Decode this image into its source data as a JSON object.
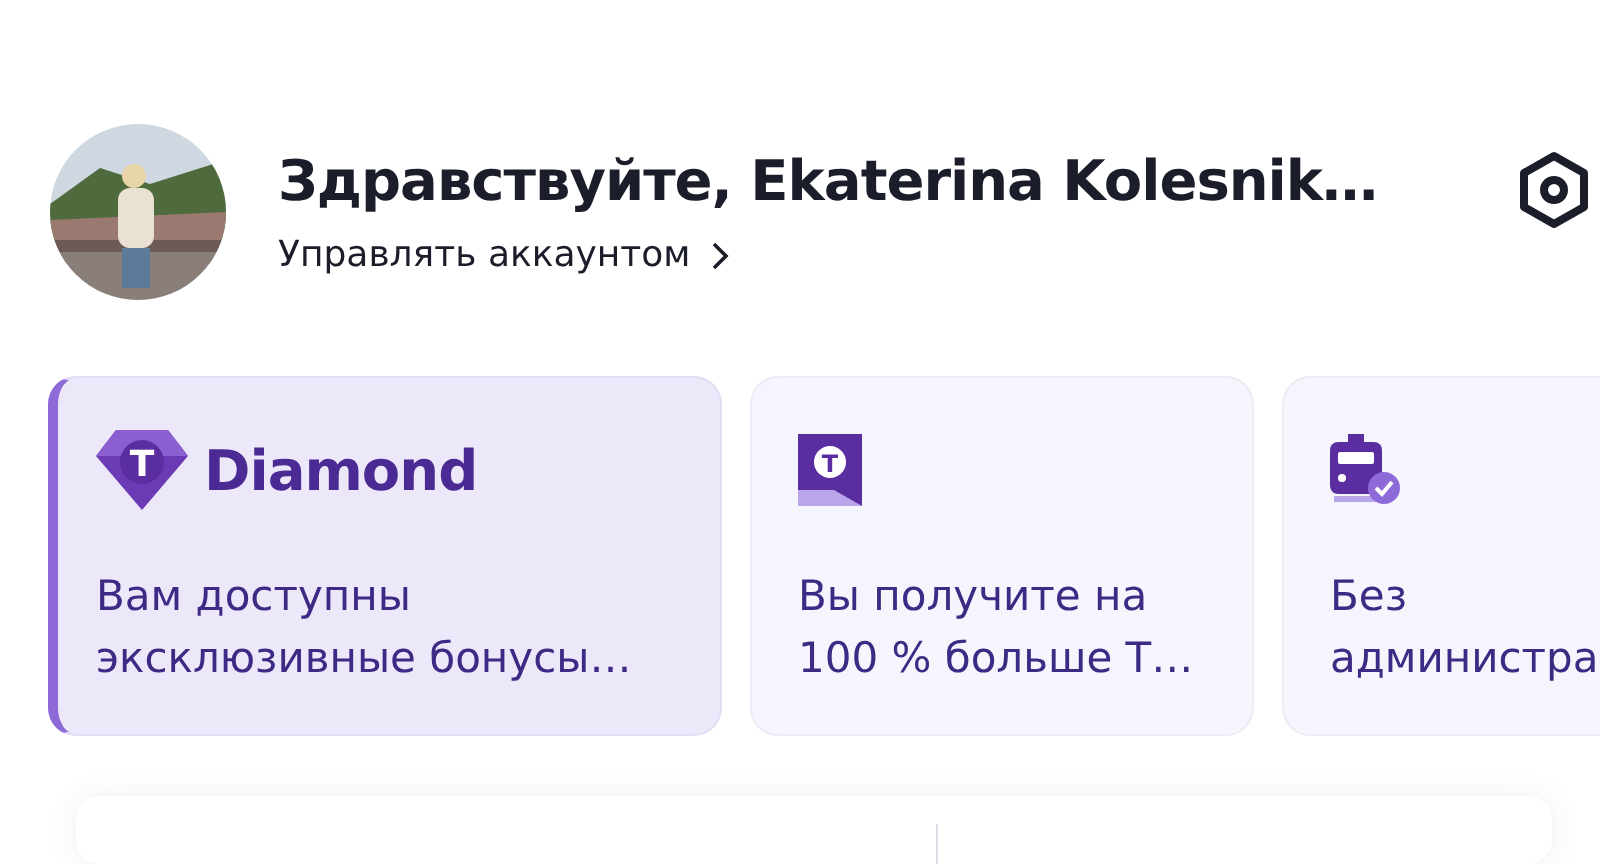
{
  "profile": {
    "greeting": "Здравствуйте, Ekaterina Kolesnik…",
    "manage_link": "Управлять аккаунтом"
  },
  "cards": [
    {
      "kind": "diamond",
      "selected": true,
      "icon_letter": "Т",
      "title": "Diamond",
      "text_lines": [
        "Вам доступны",
        "эксклюзивные бонусы…"
      ]
    },
    {
      "kind": "flag",
      "selected": false,
      "icon_letter": "Т",
      "text_lines": [
        "Вы получите на",
        "100 % больше Т…"
      ]
    },
    {
      "kind": "train",
      "selected": false,
      "text_lines": [
        "Без",
        "администра"
      ]
    }
  ]
}
